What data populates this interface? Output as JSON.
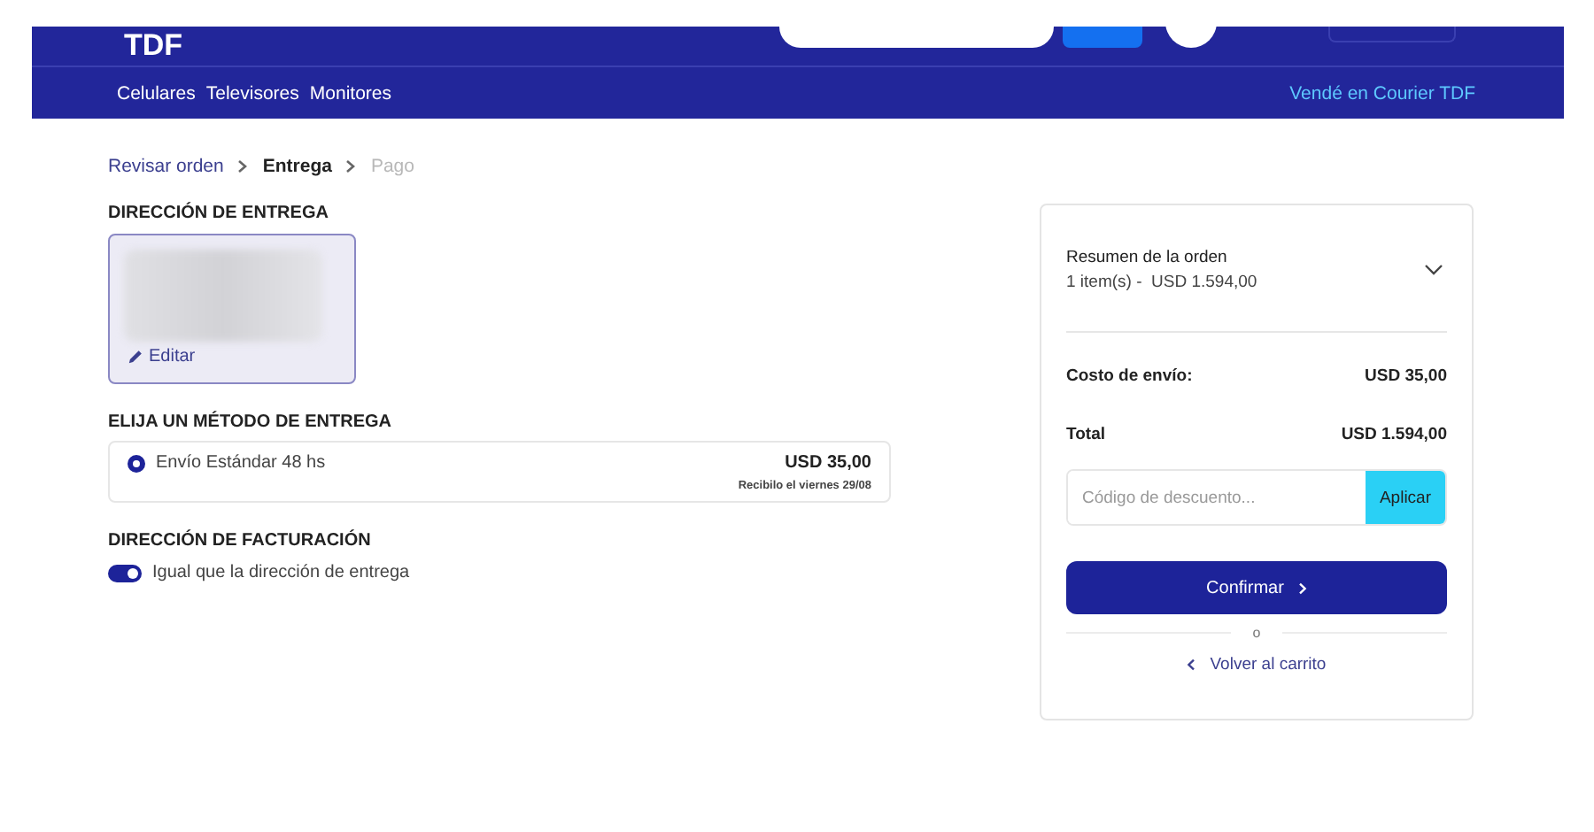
{
  "header": {
    "logo": "TDF",
    "nav": [
      "Celulares",
      "Televisores",
      "Monitores"
    ],
    "sell_link": "Vendé en Courier TDF"
  },
  "breadcrumb": [
    {
      "label": "Revisar orden",
      "selected": false,
      "disabled": false
    },
    {
      "label": "Entrega",
      "selected": true,
      "disabled": false
    },
    {
      "label": "Pago",
      "selected": false,
      "disabled": true
    }
  ],
  "delivery_address": {
    "title": "DIRECCIÓN DE ENTREGA",
    "edit": "Editar"
  },
  "delivery_method": {
    "title": "ELIJA UN MÉTODO DE ENTREGA",
    "options": [
      {
        "name": "Envío Estándar 48 hs",
        "price": "USD 35,00",
        "note": "Recibilo el viernes 29/08",
        "selected": true
      }
    ]
  },
  "billing": {
    "title": "DIRECCIÓN DE FACTURACIÓN",
    "same_as_delivery": {
      "label": "Igual que la dirección de entrega",
      "on": true
    }
  },
  "summary": {
    "title": "Resumen de la orden",
    "subtitle": "1 item(s) -  USD 1.594,00",
    "expanded": false,
    "lines": [
      {
        "label": "Costo de envío:",
        "value": "USD 35,00"
      },
      {
        "label": "Total",
        "value": "USD 1.594,00"
      }
    ],
    "discount": {
      "placeholder": "Código de descuento...",
      "button": "Aplicar"
    },
    "confirm": "Confirmar",
    "separator": "o",
    "back": "Volver al carrito"
  }
}
